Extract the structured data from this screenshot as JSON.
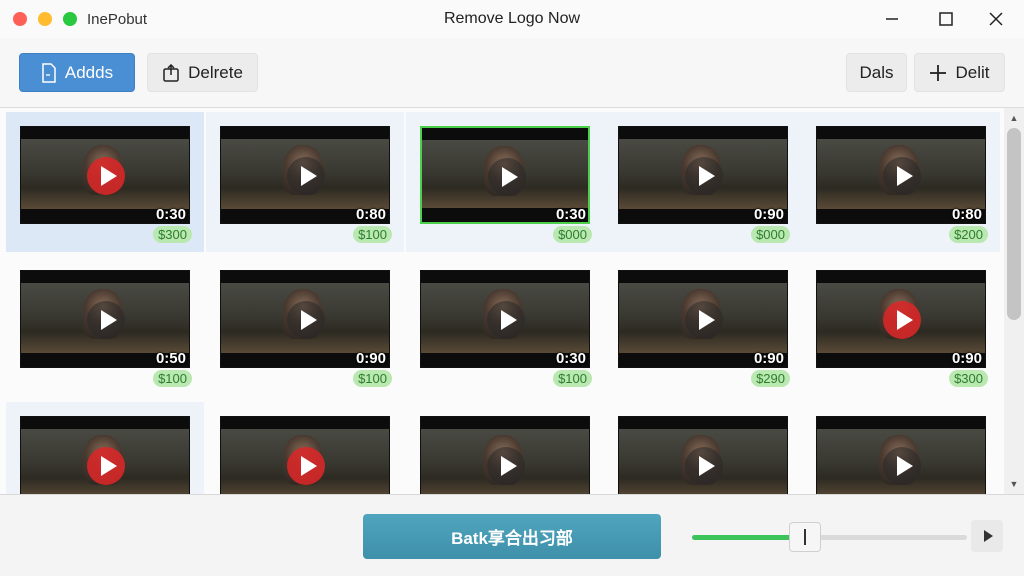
{
  "window": {
    "app_name": "InePobut",
    "title": "Remove Logo Now"
  },
  "toolbar": {
    "add_label": "Addds",
    "delete_label": "Delrete",
    "dals_label": "Dals",
    "delit_label": "Delit"
  },
  "videos": [
    {
      "duration": "0:30",
      "price": "$300"
    },
    {
      "duration": "0:80",
      "price": "$100"
    },
    {
      "duration": "0:30",
      "price": "$000"
    },
    {
      "duration": "0:90",
      "price": "$000"
    },
    {
      "duration": "0:80",
      "price": "$200"
    },
    {
      "duration": "0:50",
      "price": "$100"
    },
    {
      "duration": "0:90",
      "price": "$100"
    },
    {
      "duration": "0:30",
      "price": "$100"
    },
    {
      "duration": "0:90",
      "price": "$290"
    },
    {
      "duration": "0:90",
      "price": "$300"
    },
    {
      "duration": "",
      "price": ""
    },
    {
      "duration": "",
      "price": ""
    },
    {
      "duration": "",
      "price": ""
    },
    {
      "duration": "",
      "price": ""
    },
    {
      "duration": "",
      "price": ""
    }
  ],
  "bottom": {
    "batch_label": "Batk享合出习部",
    "progress": 0.41
  },
  "colors": {
    "primary": "#4a8fd4",
    "batch": "#3f90aa",
    "progress": "#3cc35a",
    "price_badge": "#b9e8b0",
    "selection": "#dde8f6"
  }
}
